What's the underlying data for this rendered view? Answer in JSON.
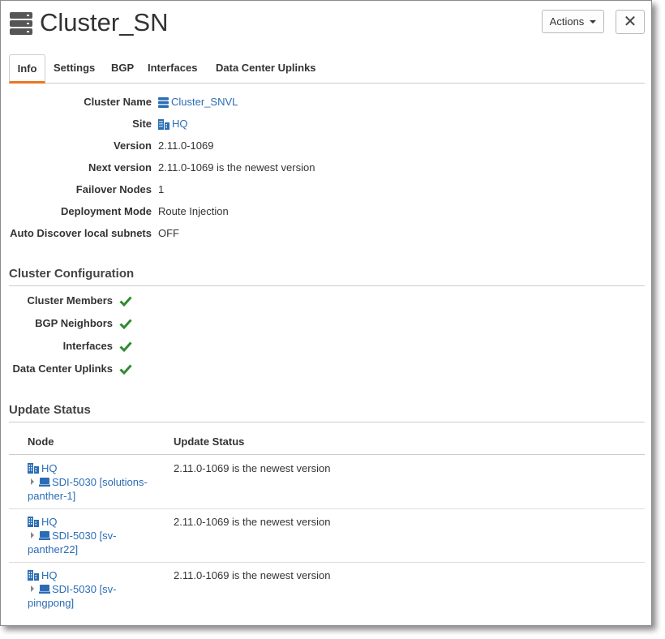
{
  "header": {
    "title": "Cluster_SN",
    "title_icon": "server-stack-icon",
    "actions_label": "Actions",
    "close_icon": "close-icon"
  },
  "tabs": [
    {
      "label": "Info",
      "active": true
    },
    {
      "label": "Settings"
    },
    {
      "label": "BGP"
    },
    {
      "label": "Interfaces"
    },
    {
      "label": "Data Center Uplinks"
    }
  ],
  "info": {
    "cluster_name_label": "Cluster Name",
    "cluster_name_value": "Cluster_SNVL",
    "site_label": "Site",
    "site_value": "HQ",
    "version_label": "Version",
    "version_value": "2.11.0-1069",
    "next_version_label": "Next version",
    "next_version_value": "2.11.0-1069 is the newest version",
    "failover_label": "Failover Nodes",
    "failover_value": "1",
    "deployment_label": "Deployment Mode",
    "deployment_value": "Route Injection",
    "auto_discover_label": "Auto Discover local subnets",
    "auto_discover_value": "OFF"
  },
  "cluster_config": {
    "title": "Cluster Configuration",
    "items": [
      {
        "label": "Cluster Members",
        "status": "ok"
      },
      {
        "label": "BGP Neighbors",
        "status": "ok"
      },
      {
        "label": "Interfaces",
        "status": "ok"
      },
      {
        "label": "Data Center Uplinks",
        "status": "ok"
      }
    ]
  },
  "update_status": {
    "title": "Update Status",
    "col_node": "Node",
    "col_status": "Update Status",
    "rows": [
      {
        "site": "HQ",
        "device": "SDI-5030 [solutions-panther-1]",
        "status": "2.11.0-1069 is the newest version"
      },
      {
        "site": "HQ",
        "device": "SDI-5030 [sv-panther22]",
        "status": "2.11.0-1069 is the newest version"
      },
      {
        "site": "HQ",
        "device": "SDI-5030 [sv-pingpong]",
        "status": "2.11.0-1069 is the newest version"
      }
    ]
  },
  "colors": {
    "link": "#2a6db5",
    "tab_active_underline": "#e87722",
    "check": "#2e8b2e"
  }
}
